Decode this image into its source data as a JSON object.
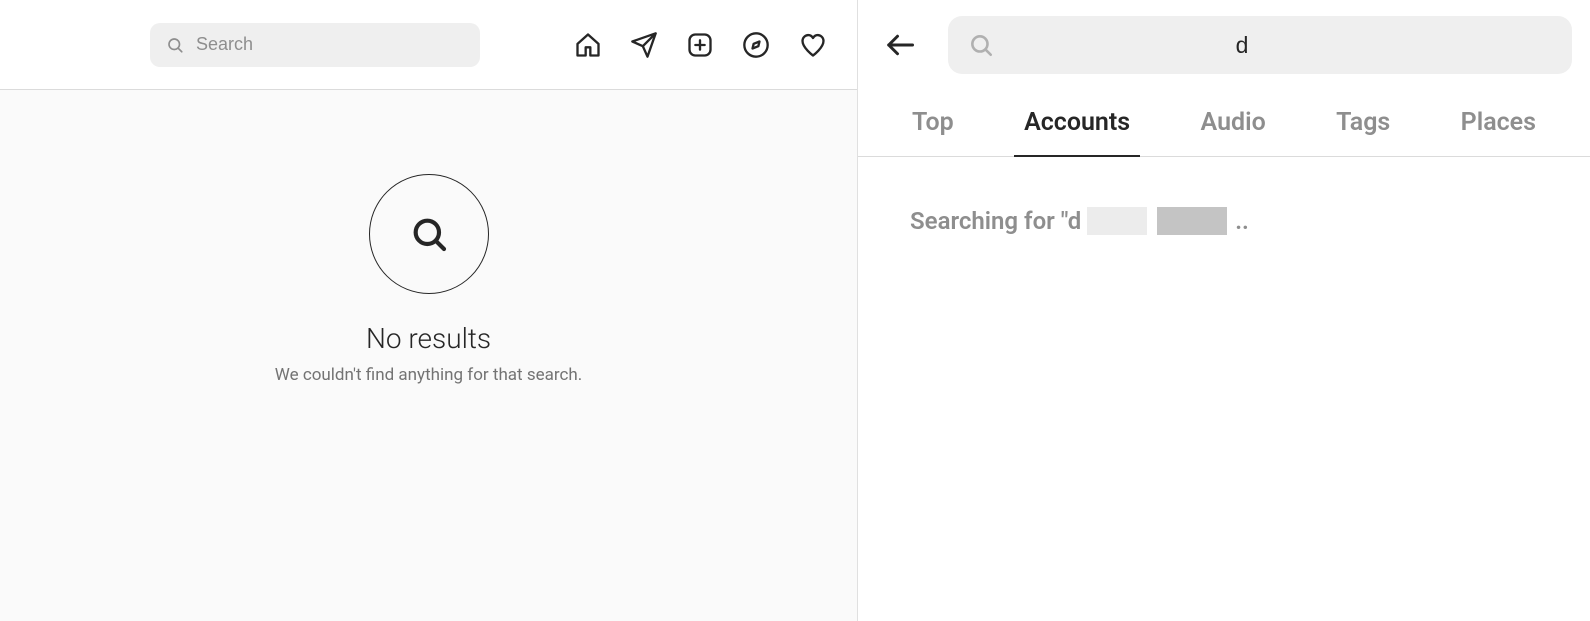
{
  "left": {
    "search_placeholder": "Search",
    "nav": [
      {
        "name": "home-icon"
      },
      {
        "name": "messages-icon"
      },
      {
        "name": "create-icon"
      },
      {
        "name": "explore-icon"
      },
      {
        "name": "activity-icon"
      }
    ],
    "no_results_title": "No results",
    "no_results_subtitle": "We couldn't find anything for that search."
  },
  "right": {
    "search_value": "d",
    "tabs": [
      {
        "label": "Top",
        "active": false
      },
      {
        "label": "Accounts",
        "active": true
      },
      {
        "label": "Audio",
        "active": false
      },
      {
        "label": "Tags",
        "active": false
      },
      {
        "label": "Places",
        "active": false
      }
    ],
    "searching_prefix": "Searching for \"d",
    "searching_suffix": ".."
  }
}
